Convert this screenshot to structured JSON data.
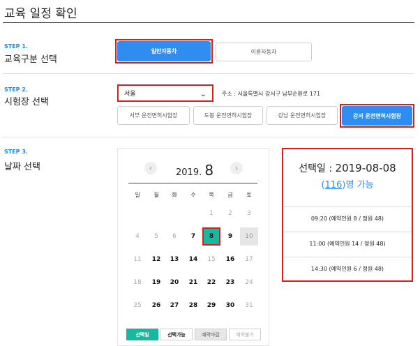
{
  "page": {
    "title": "교육 일정 확인"
  },
  "step1": {
    "step_label": "STEP 1.",
    "title": "교육구분 선택",
    "options": [
      "일반자동차",
      "이륜자동차"
    ]
  },
  "step2": {
    "step_label": "STEP 2.",
    "title": "시험장 선택",
    "region_value": "서울",
    "address_label": "주소 : 서울특별시 강서구 남부순환로 171",
    "centers": [
      "서부 운전면허시험장",
      "도봉 운전면허시험장",
      "강남 운전면허시험장",
      "강서 운전면허시험장"
    ]
  },
  "step3": {
    "step_label": "STEP 3.",
    "title": "날짜 선택"
  },
  "calendar": {
    "prev_icon": "‹",
    "next_icon": "›",
    "year": "2019.",
    "month": "8",
    "weekdays": [
      "일",
      "월",
      "화",
      "수",
      "목",
      "금",
      "토"
    ],
    "weeks": [
      [
        "",
        "",
        "",
        "",
        "1",
        "2",
        "3"
      ],
      [
        "4",
        "5",
        "6",
        "7",
        "8",
        "9",
        "10"
      ],
      [
        "11",
        "12",
        "13",
        "14",
        "15",
        "16",
        "17"
      ],
      [
        "18",
        "19",
        "20",
        "21",
        "22",
        "23",
        "24"
      ],
      [
        "25",
        "26",
        "27",
        "28",
        "29",
        "30",
        "31"
      ]
    ],
    "available_days": [
      "7",
      "9",
      "12",
      "13",
      "14",
      "16",
      "19",
      "20",
      "21",
      "22",
      "23",
      "26",
      "27",
      "28",
      "29",
      "30"
    ],
    "closed_days": [
      "10"
    ],
    "selected_day": "8",
    "legend": [
      "선택일",
      "선택가능",
      "예약마감",
      "예약불가"
    ]
  },
  "info": {
    "selected_label": "선택일 :",
    "selected_date": "2019-08-08",
    "count_open": "(",
    "count": "116",
    "count_close": ")명 가능",
    "slots": [
      "09:20 (예약인원 8 / 정원 48)",
      "11:00 (예약인원 14 / 정원 48)",
      "14:30 (예약인원 6 / 정원 48)"
    ]
  },
  "colors": {
    "accent_blue": "#2f8cf0",
    "selected_teal": "#17b8a0",
    "highlight_red": "#e01b1b"
  }
}
